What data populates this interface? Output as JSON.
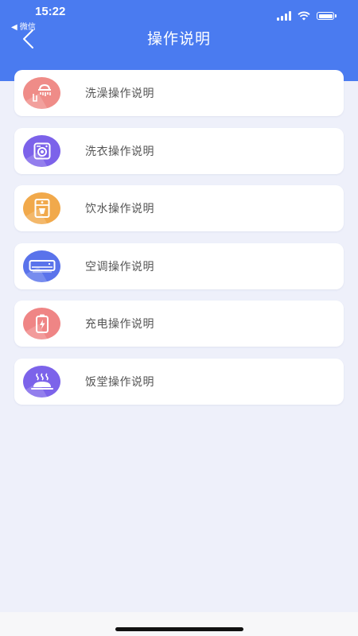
{
  "status_bar": {
    "time": "15:22",
    "back_app": "◀ 微信",
    "icons": [
      "signal-icon",
      "wifi-icon",
      "battery-icon"
    ]
  },
  "header": {
    "title": "操作说明",
    "back_icon": "chevron-left-icon",
    "background": "#4a7bf0"
  },
  "items": [
    {
      "label": "洗澡操作说明",
      "icon": "shower-icon",
      "color": "#ef8c88"
    },
    {
      "label": "洗衣操作说明",
      "icon": "washing-machine-icon",
      "color": "#7c62ea"
    },
    {
      "label": "饮水操作说明",
      "icon": "water-dispenser-icon",
      "color": "#f1a94b"
    },
    {
      "label": "空调操作说明",
      "icon": "air-conditioner-icon",
      "color": "#5a73eb"
    },
    {
      "label": "充电操作说明",
      "icon": "charging-icon",
      "color": "#ef8585"
    },
    {
      "label": "饭堂操作说明",
      "icon": "dining-icon",
      "color": "#7c63ea"
    }
  ]
}
